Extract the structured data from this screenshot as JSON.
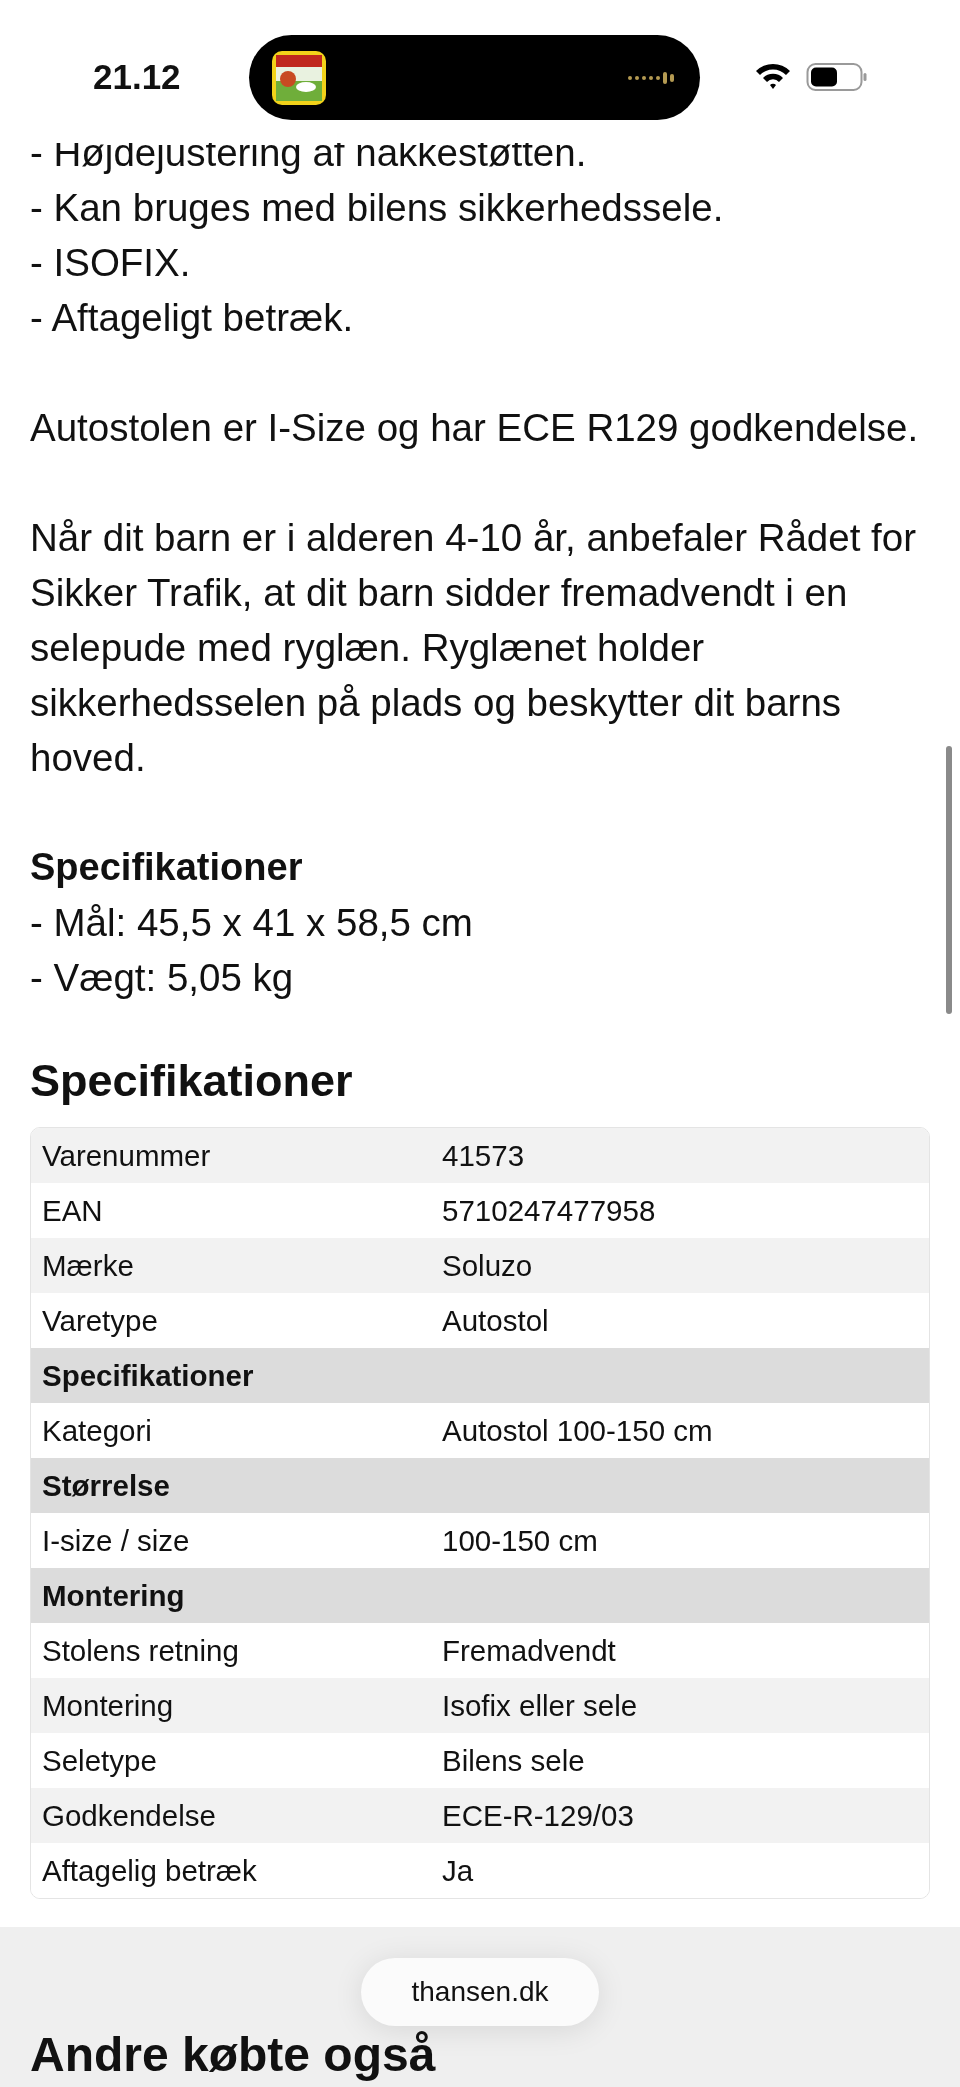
{
  "status_bar": {
    "time": "21.12"
  },
  "description": {
    "blocks": [
      {
        "kind": "bullets",
        "items": [
          "- Højdejustering af nakkestøtten.",
          "- Kan bruges med bilens sikkerhedssele.",
          "- ISOFIX.",
          "- Aftageligt betræk."
        ]
      },
      {
        "kind": "paragraph",
        "text": "Autostolen er I-Size og har ECE R129 godkendelse."
      },
      {
        "kind": "paragraph",
        "text": "Når dit barn er i alderen 4-10 år, anbefaler Rådet for Sikker Trafik, at dit barn sidder fremadvendt i en selepude med ryglæn. Ryglænet holder sikkerhedsselen på plads og beskytter dit barns hoved."
      },
      {
        "kind": "subsection",
        "title": "Specifikationer",
        "items": [
          "- Mål: 45,5 x 41 x 58,5 cm",
          "- Vægt: 5,05 kg"
        ]
      }
    ]
  },
  "specifications": {
    "title": "Specifikationer",
    "rows": [
      {
        "kind": "row",
        "label": "Varenummer",
        "value": "41573"
      },
      {
        "kind": "row",
        "label": "EAN",
        "value": "5710247477958"
      },
      {
        "kind": "row",
        "label": "Mærke",
        "value": "Soluzo"
      },
      {
        "kind": "row",
        "label": "Varetype",
        "value": "Autostol"
      },
      {
        "kind": "group",
        "label": "Specifikationer"
      },
      {
        "kind": "row",
        "label": "Kategori",
        "value": "Autostol 100-150 cm"
      },
      {
        "kind": "group",
        "label": "Størrelse"
      },
      {
        "kind": "row",
        "label": "I-size / size",
        "value": "100-150 cm"
      },
      {
        "kind": "group",
        "label": "Montering"
      },
      {
        "kind": "row",
        "label": "Stolens retning",
        "value": "Fremadvendt"
      },
      {
        "kind": "row",
        "label": "Montering",
        "value": "Isofix eller sele"
      },
      {
        "kind": "row",
        "label": "Seletype",
        "value": "Bilens sele"
      },
      {
        "kind": "row",
        "label": "Godkendelse",
        "value": "ECE-R-129/03"
      },
      {
        "kind": "row",
        "label": "Aftagelig betræk",
        "value": "Ja"
      }
    ]
  },
  "related": {
    "title": "Andre købte også"
  },
  "address_pill": {
    "text": "thansen.dk"
  }
}
